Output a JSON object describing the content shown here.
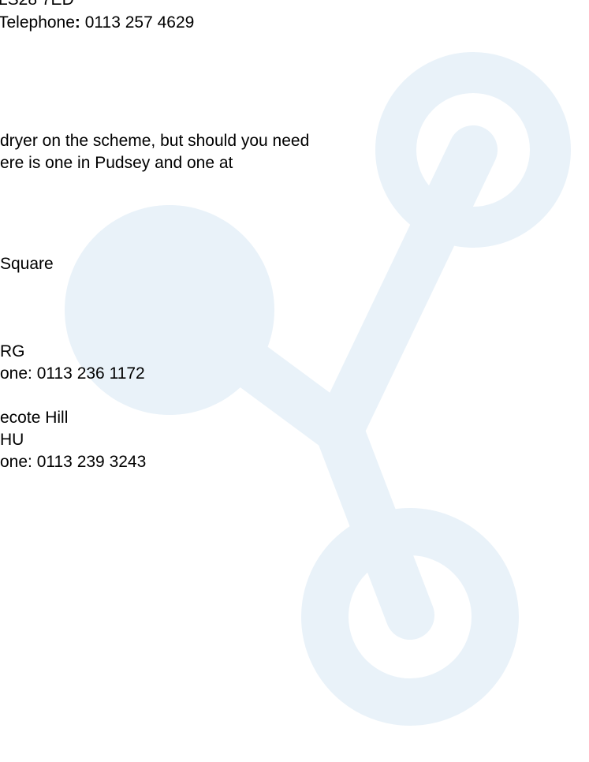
{
  "document": {
    "header_block": {
      "postcode_partial": "LS28 7ED",
      "telephone_label": "Telephone",
      "telephone_colon": ":",
      "telephone_number": " 0113 257 4629"
    },
    "paragraph": {
      "line1": "dryer on the scheme, but should you need",
      "line2": "ere is one in Pudsey and one at"
    },
    "launderette_1": {
      "address_line": "Square",
      "postcode": "RG",
      "phone": "one: 0113 236 1172"
    },
    "launderette_2": {
      "address_line": "ecote Hill",
      "postcode": "HU",
      "phone": "one: 0113 239 3243"
    }
  },
  "watermark": {
    "icon": "connected-nodes-logo",
    "color": "#e9f2f9"
  }
}
